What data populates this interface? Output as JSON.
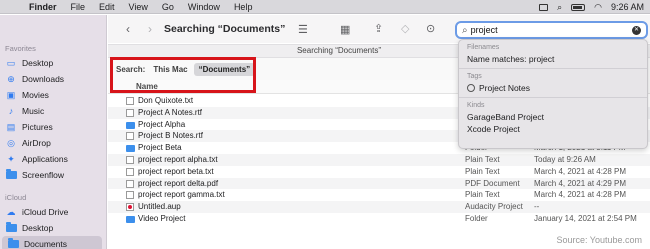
{
  "menubar": {
    "app_name": "Finder",
    "items": [
      "File",
      "Edit",
      "View",
      "Go",
      "Window",
      "Help"
    ],
    "time": "9:26 AM"
  },
  "sidebar": {
    "favorites_header": "Favorites",
    "favorites": [
      {
        "label": "Desktop",
        "icon": "desktop-icon"
      },
      {
        "label": "Downloads",
        "icon": "downloads-icon"
      },
      {
        "label": "Movies",
        "icon": "movies-icon"
      },
      {
        "label": "Music",
        "icon": "music-icon"
      },
      {
        "label": "Pictures",
        "icon": "pictures-icon"
      },
      {
        "label": "AirDrop",
        "icon": "airdrop-icon"
      },
      {
        "label": "Applications",
        "icon": "applications-icon"
      },
      {
        "label": "Screenflow",
        "icon": "folder-icon"
      }
    ],
    "icloud_header": "iCloud",
    "icloud": [
      {
        "label": "iCloud Drive",
        "icon": "cloud-icon"
      },
      {
        "label": "Desktop",
        "icon": "folder-icon"
      },
      {
        "label": "Documents",
        "icon": "folder-icon"
      }
    ]
  },
  "toolbar": {
    "title": "Searching “Documents”",
    "path_label": "Searching “Documents”",
    "search_value": "project"
  },
  "scope": {
    "label": "Search:",
    "this_mac": "This Mac",
    "documents": "“Documents”"
  },
  "list": {
    "header_name": "Name",
    "rows": [
      {
        "name": "Don Quixote.txt",
        "kind": "",
        "date": "",
        "icon": "doc"
      },
      {
        "name": "Project A Notes.rtf",
        "kind": "",
        "date": "",
        "icon": "doc"
      },
      {
        "name": "Project Alpha",
        "kind": "",
        "date": "",
        "icon": "folder"
      },
      {
        "name": "Project B Notes.rtf",
        "kind": "",
        "date": "",
        "icon": "doc"
      },
      {
        "name": "Project Beta",
        "kind": "Folder",
        "date": "March 1, 2021 at 3:11 PM",
        "icon": "folder"
      },
      {
        "name": "project report alpha.txt",
        "kind": "Plain Text",
        "date": "Today at 9:26 AM",
        "icon": "doc"
      },
      {
        "name": "project report beta.txt",
        "kind": "Plain Text",
        "date": "March 4, 2021 at 4:28 PM",
        "icon": "doc"
      },
      {
        "name": "project report delta.pdf",
        "kind": "PDF Document",
        "date": "March 4, 2021 at 4:29 PM",
        "icon": "doc"
      },
      {
        "name": "project report gamma.txt",
        "kind": "Plain Text",
        "date": "March 4, 2021 at 4:28 PM",
        "icon": "doc"
      },
      {
        "name": "Untitled.aup",
        "kind": "Audacity Project",
        "date": "--",
        "icon": "aup"
      },
      {
        "name": "Video Project",
        "kind": "Folder",
        "date": "January 14, 2021 at 2:54 PM",
        "icon": "folder"
      }
    ]
  },
  "popup": {
    "filenames_header": "Filenames",
    "name_matches": "Name matches: project",
    "tags_header": "Tags",
    "tag": "Project Notes",
    "kinds_header": "Kinds",
    "kinds": [
      "GarageBand Project",
      "Xcode Project"
    ]
  },
  "source_credit": "Source: Youtube.com"
}
